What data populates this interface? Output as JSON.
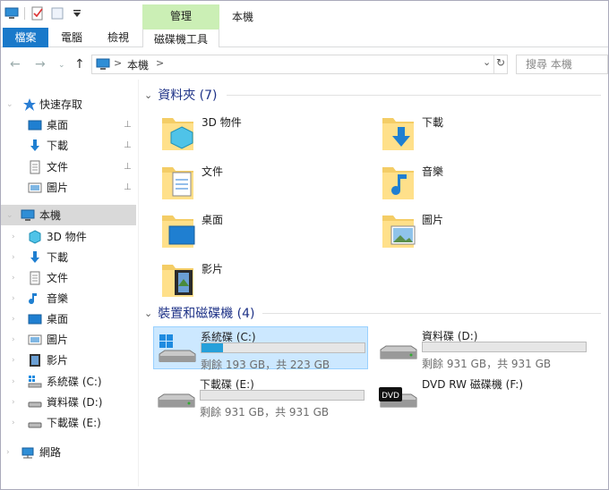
{
  "window": {
    "title": "本機",
    "context_group": "管理"
  },
  "ribbon": {
    "tabs": [
      {
        "label": "檔案"
      },
      {
        "label": "電腦"
      },
      {
        "label": "檢視"
      },
      {
        "label": "磁碟機工具"
      }
    ]
  },
  "address": {
    "location": "本機",
    "separator": ">",
    "search_placeholder": "搜尋 本機"
  },
  "sidebar": {
    "quick_access": {
      "label": "快速存取",
      "items": [
        {
          "label": "桌面"
        },
        {
          "label": "下載"
        },
        {
          "label": "文件"
        },
        {
          "label": "圖片"
        }
      ]
    },
    "this_pc": {
      "label": "本機",
      "items": [
        {
          "label": "3D 物件"
        },
        {
          "label": "下載"
        },
        {
          "label": "文件"
        },
        {
          "label": "音樂"
        },
        {
          "label": "桌面"
        },
        {
          "label": "圖片"
        },
        {
          "label": "影片"
        },
        {
          "label": "系統碟 (C:)"
        },
        {
          "label": "資料碟 (D:)"
        },
        {
          "label": "下載碟 (E:)"
        }
      ]
    },
    "network": {
      "label": "網路"
    }
  },
  "folders_section": {
    "title": "資料夾 (7)",
    "items": [
      {
        "name": "3D 物件",
        "icon": "3d-objects-icon"
      },
      {
        "name": "下載",
        "icon": "download-icon"
      },
      {
        "name": "文件",
        "icon": "document-icon"
      },
      {
        "name": "音樂",
        "icon": "music-icon"
      },
      {
        "name": "桌面",
        "icon": "desktop-icon"
      },
      {
        "name": "圖片",
        "icon": "pictures-icon"
      },
      {
        "name": "影片",
        "icon": "video-icon"
      }
    ]
  },
  "devices_section": {
    "title": "裝置和磁碟機 (4)",
    "items": [
      {
        "name": "系統碟 (C:)",
        "free": "剩餘 193 GB，共 223 GB",
        "used_fraction": 0.13,
        "icon": "windows-drive-icon"
      },
      {
        "name": "資料碟 (D:)",
        "free": "剩餘 931 GB，共 931 GB",
        "used_fraction": 0.0,
        "icon": "hdd-icon"
      },
      {
        "name": "下載碟 (E:)",
        "free": "剩餘 931 GB，共 931 GB",
        "used_fraction": 0.0,
        "icon": "hdd-icon"
      },
      {
        "name": "DVD RW 磁碟機 (F:)",
        "icon": "dvd-drive-icon"
      }
    ]
  },
  "colors": {
    "accent": "#1979ca",
    "ctx_tab": "#cbefb5",
    "selection": "#cce8ff",
    "bar_fill": "#26a0da"
  }
}
